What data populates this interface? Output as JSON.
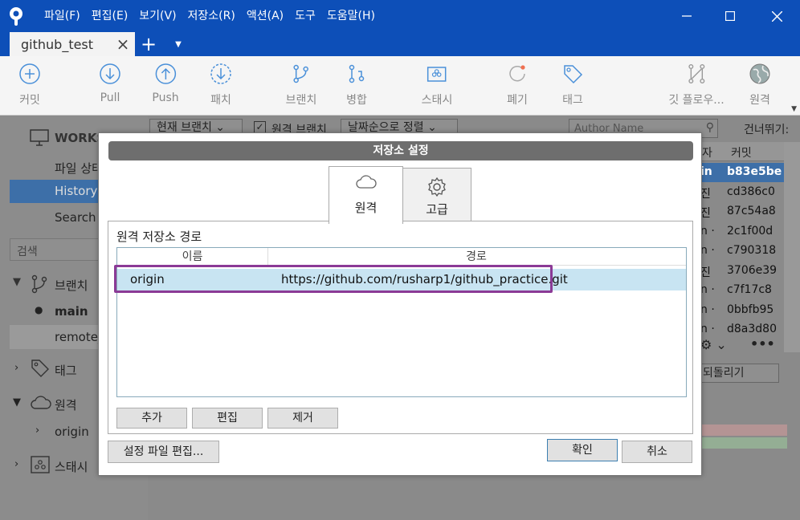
{
  "titlebar": {
    "menus": [
      "파일(F)",
      "편집(E)",
      "보기(V)",
      "저장소(R)",
      "액션(A)",
      "도구",
      "도움말(H)"
    ]
  },
  "tabs": {
    "repo": "github_test"
  },
  "toolbar": {
    "commit": "커밋",
    "pull": "Pull",
    "push": "Push",
    "fetch": "패치",
    "branch": "브랜치",
    "merge": "병합",
    "stash": "스태시",
    "discard": "폐기",
    "tag": "태그",
    "git_flow": "깃 플로우...",
    "remote": "원격"
  },
  "sidebar": {
    "workspace": "WORKS",
    "file_status": "파일 상태",
    "history": "History",
    "search": "Search",
    "search_placeholder": "검색",
    "branches": "브랜치",
    "main": "main",
    "remote_item": "remote_",
    "tags": "태그",
    "remotes": "원격",
    "origin": "origin",
    "stash": "스태시"
  },
  "main": {
    "branch_filter": "현재 브랜치",
    "remote_branch": "원격 브랜치",
    "sort": "날짜순으로 정렬",
    "author_placeholder": "Author Name",
    "skip": "건너뛰기:",
    "col_author_tail": "자",
    "col_commit": "커밋",
    "rows": [
      {
        "author": "in",
        "hash": "b83e5be"
      },
      {
        "author": "진",
        "hash": "cd386c0"
      },
      {
        "author": "진",
        "hash": "87c54a8"
      },
      {
        "author": "n ·",
        "hash": "2c1f00d"
      },
      {
        "author": "n ·",
        "hash": "c790318"
      },
      {
        "author": "진",
        "hash": "3706e39"
      },
      {
        "author": "n ·",
        "hash": "c7f17c8"
      },
      {
        "author": "n ·",
        "hash": "0bbfb95"
      },
      {
        "author": "n ·",
        "hash": "d8a3d80"
      }
    ],
    "revert": "되돌리기"
  },
  "dialog": {
    "title": "저장소 설정",
    "tab_remote": "원격",
    "tab_advanced": "고급",
    "section": "원격 저장소 경로",
    "col_name": "이름",
    "col_path": "경로",
    "remote_name": "origin",
    "remote_url": "https://github.com/rusharp1/github_practice.git",
    "add": "추가",
    "edit": "편집",
    "remove": "제거",
    "edit_config": "설정 파일 편집...",
    "ok": "확인",
    "cancel": "취소"
  },
  "colors": {
    "titlebar": "#0d4fb8",
    "highlight": "#8b3a96",
    "selected_row": "#c8e4f2"
  }
}
